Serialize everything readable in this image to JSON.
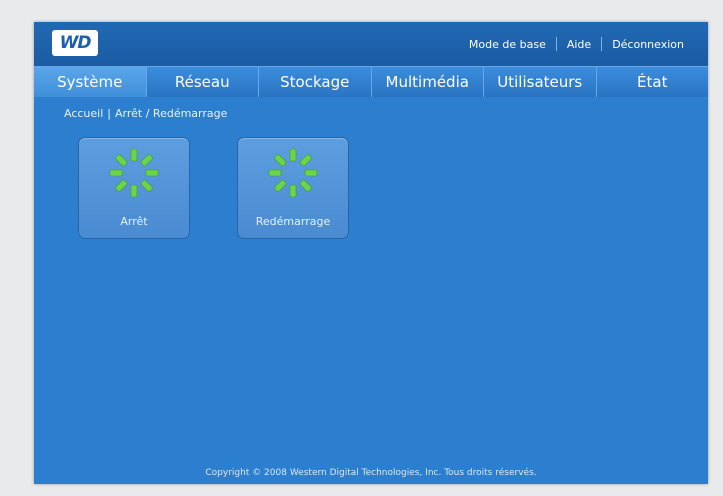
{
  "header": {
    "logo_text": "WD",
    "links": {
      "basic_mode": "Mode de base",
      "help": "Aide",
      "logout": "Déconnexion"
    }
  },
  "tabs": [
    {
      "label": "Système",
      "active": true
    },
    {
      "label": "Réseau",
      "active": false
    },
    {
      "label": "Stockage",
      "active": false
    },
    {
      "label": "Multimédia",
      "active": false
    },
    {
      "label": "Utilisateurs",
      "active": false
    },
    {
      "label": "État",
      "active": false
    }
  ],
  "breadcrumb": {
    "home": "Accueil",
    "separator": "|",
    "current": "Arrêt / Redémarrage"
  },
  "actions": [
    {
      "label": "Arrêt",
      "icon": "spinner-icon"
    },
    {
      "label": "Redémarrage",
      "icon": "spinner-icon"
    }
  ],
  "footer": "Copyright © 2008 Western Digital Technologies, Inc. Tous droits réservés.",
  "colors": {
    "background": "#2c7fce",
    "spinner": "#6cd44a"
  }
}
